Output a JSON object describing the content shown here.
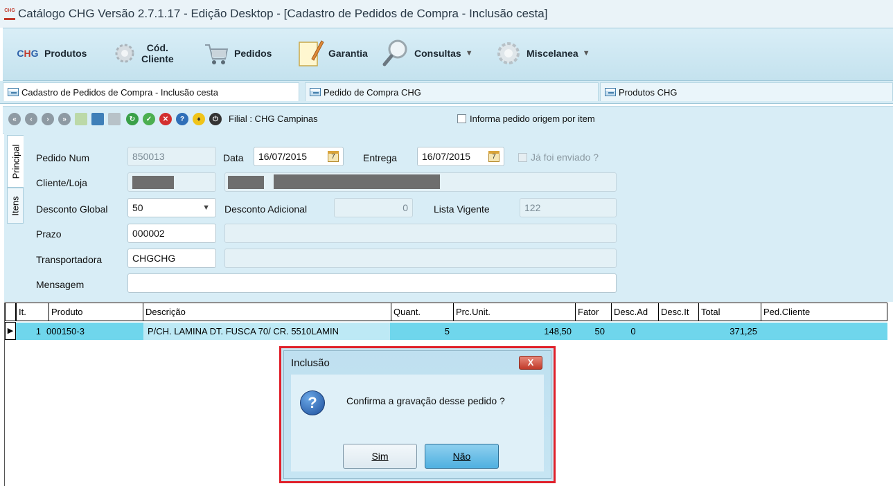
{
  "window": {
    "logo_text": "CHG",
    "title": "Catálogo CHG Versão 2.7.1.17 - Edição Desktop - [Cadastro de Pedidos de Compra - Inclusão cesta]"
  },
  "ribbon": {
    "items": [
      {
        "label": "Produtos",
        "icon": "chg-logo-icon"
      },
      {
        "label_line1": "Cód.",
        "label_line2": "Cliente",
        "icon": "gear-icon"
      },
      {
        "label": "Pedidos",
        "icon": "shopping-cart-icon"
      },
      {
        "label": "Garantia",
        "icon": "notepad-pencil-icon"
      },
      {
        "label": "Consultas",
        "icon": "magnifier-icon",
        "arrow": "▼"
      },
      {
        "label": "Miscelanea",
        "icon": "gears-icon",
        "arrow": "▼"
      }
    ]
  },
  "doc_tabs": [
    {
      "label": "Cadastro de Pedidos de Compra - Inclusão cesta"
    },
    {
      "label": "Pedido de Compra CHG"
    },
    {
      "label": "Produtos CHG"
    }
  ],
  "toolbar": {
    "filial": "Filial : CHG Campinas",
    "checkbox_label": "Informa pedido origem por item"
  },
  "side_tabs": {
    "principal": "Principal",
    "itens": "Itens"
  },
  "form": {
    "pedido_num_label": "Pedido Num",
    "pedido_num": "850013",
    "data_label": "Data",
    "data": "16/07/2015",
    "entrega_label": "Entrega",
    "entrega": "16/07/2015",
    "ja_enviado_label": "Já foi enviado ?",
    "cliente_loja_label": "Cliente/Loja",
    "desconto_global_label": "Desconto Global",
    "desconto_global": "50",
    "desconto_adicional_label": "Desconto Adicional",
    "desconto_adicional": "0",
    "lista_vigente_label": "Lista Vigente",
    "lista_vigente": "122",
    "prazo_label": "Prazo",
    "prazo": "000002",
    "transportadora_label": "Transportadora",
    "transportadora": "CHGCHG",
    "mensagem_label": "Mensagem",
    "mensagem": "",
    "calendar_glyph": "7",
    "dropdown_arrow": "▼"
  },
  "grid": {
    "headers": [
      "It.",
      "Produto",
      "Descrição",
      "Quant.",
      "Prc.Unit.",
      "Fator",
      "Desc.Ad",
      "Desc.It",
      "Total",
      "Ped.Cliente"
    ],
    "rows": [
      {
        "it": "1",
        "produto": "000150-3",
        "descricao": "P/CH. LAMINA DT. FUSCA 70/ CR. 5510LAMIN",
        "quant": "5",
        "prc_unit": "148,50",
        "fator": "50",
        "desc_ad": "0",
        "desc_it": "",
        "total": "371,25",
        "ped_cliente": ""
      }
    ],
    "row_indicator": "▶"
  },
  "dialog": {
    "title": "Inclusão",
    "close": "X",
    "icon": "question-icon",
    "icon_glyph": "?",
    "message": "Confirma a gravação desse pedido ?",
    "yes_label": "Sim",
    "no_label": "Não"
  },
  "colors": {
    "selected_row": "#6fd6ec",
    "dialog_highlight": "#e0202a",
    "ribbon_bg": "#c4e2ee"
  }
}
